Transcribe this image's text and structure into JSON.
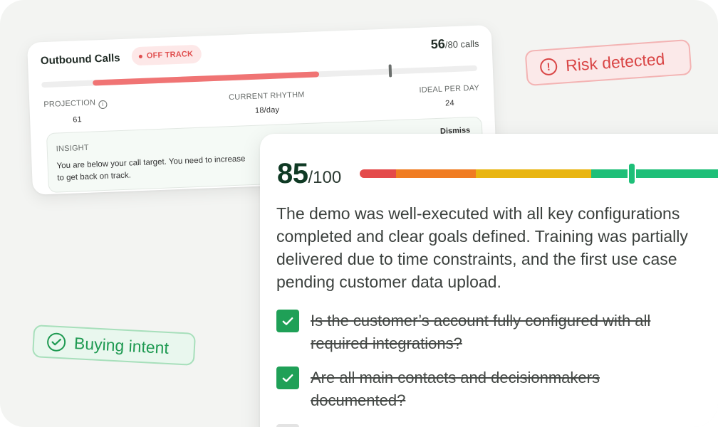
{
  "calls_card": {
    "title": "Outbound Calls",
    "status_badge": "OFF TRACK",
    "count_current": "56",
    "count_suffix": "/80 calls",
    "progress": {
      "current": 56,
      "target": 80
    },
    "projection_label": "PROJECTION",
    "projection_value": "61",
    "rhythm_label": "CURRENT RHYTHM",
    "rhythm_value": "18/day",
    "ideal_label": "IDEAL PER DAY",
    "ideal_value": "24",
    "insight_label": "INSIGHT",
    "insight_text_1": "You are below your call target. You need to increase",
    "insight_text_2": "to get back on track.",
    "dismiss_label": "Dismiss",
    "colors": {
      "off_track": "#e04f4f",
      "fill": "#f07474"
    }
  },
  "risk_badge": {
    "label": "Risk detected",
    "icon": "alert-circle-icon",
    "color": "#d94545"
  },
  "buying_badge": {
    "label": "Buying intent",
    "icon": "check-circle-icon",
    "color": "#1f9a52"
  },
  "score_card": {
    "score": "85",
    "score_max": "/100",
    "score_value": 85,
    "summary_lines": [
      "The demo was well-executed with all key configurations",
      "completed and clear goals defined. Training was partially",
      "delivered due to time constraints, and the first use case",
      "pending customer data upload."
    ],
    "checklist": [
      {
        "line1": "Is the customer’s account fully configured with all",
        "line2": "required integrations?",
        "checked": true
      },
      {
        "line1": "Are all main contacts and decisionmakers",
        "line2": "documented?",
        "checked": true
      }
    ],
    "bar_colors": [
      "#e44a4a",
      "#f07c22",
      "#e9b511",
      "#1ebf78"
    ]
  }
}
